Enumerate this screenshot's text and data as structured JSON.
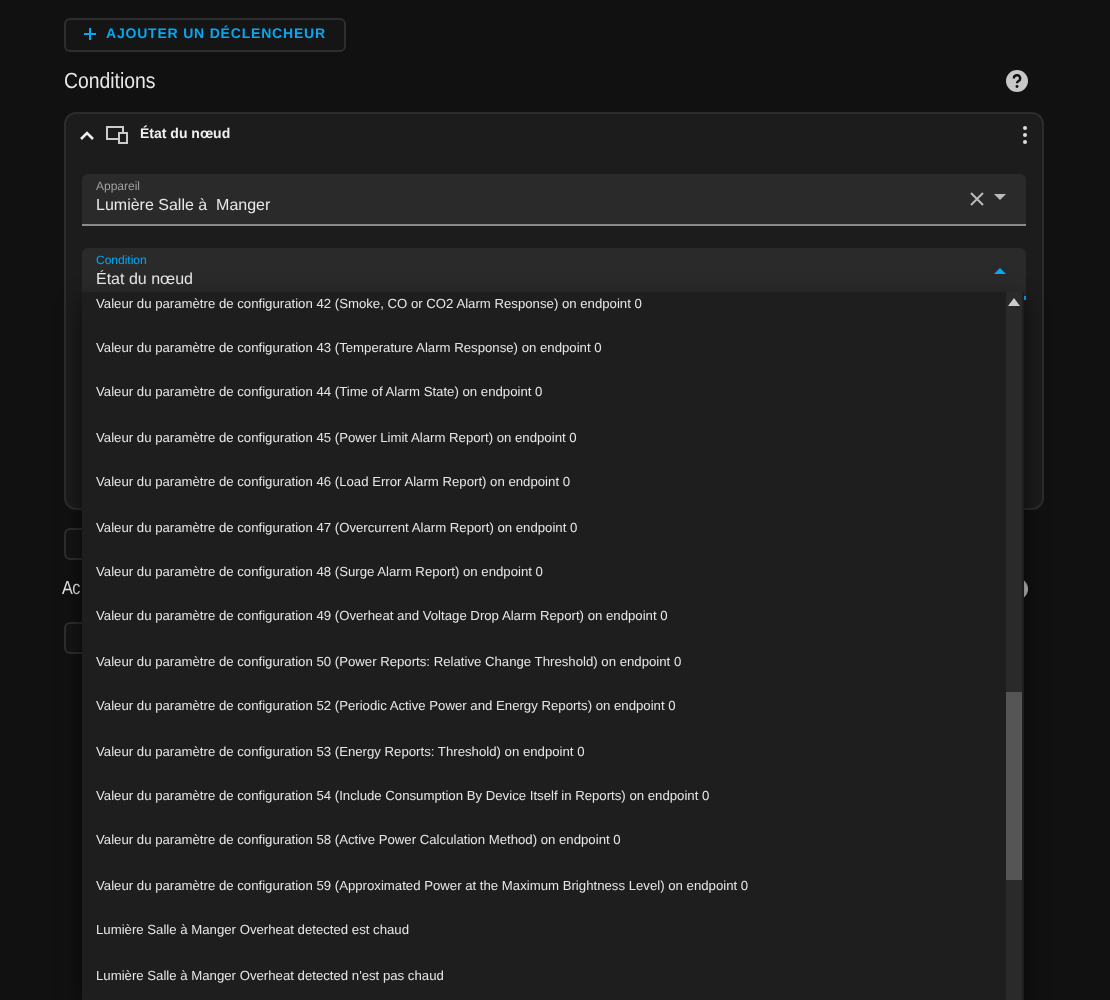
{
  "add_trigger_button": {
    "label": "AJOUTER UN DÉCLENCHEUR"
  },
  "conditions": {
    "title": "Conditions",
    "card": {
      "title": "État du nœud",
      "expanded": true,
      "fields": [
        {
          "label": "Appareil",
          "value": "Lumière Salle à  Manger",
          "focused": false,
          "clearable": true
        },
        {
          "label": "Condition",
          "value": "État du nœud",
          "focused": true,
          "clearable": false
        }
      ]
    }
  },
  "actions": {
    "title": "Ac"
  },
  "dropdown": {
    "items": [
      "Valeur du paramètre de configuration 42 (Smoke, CO or CO2 Alarm Response) on endpoint 0",
      "Valeur du paramètre de configuration 43 (Temperature Alarm Response) on endpoint 0",
      "Valeur du paramètre de configuration 44 (Time of Alarm State) on endpoint 0",
      "Valeur du paramètre de configuration 45 (Power Limit Alarm Report) on endpoint 0",
      "Valeur du paramètre de configuration 46 (Load Error Alarm Report) on endpoint 0",
      "Valeur du paramètre de configuration 47 (Overcurrent Alarm Report) on endpoint 0",
      "Valeur du paramètre de configuration 48 (Surge Alarm Report) on endpoint 0",
      "Valeur du paramètre de configuration 49 (Overheat and Voltage Drop Alarm Report) on endpoint 0",
      "Valeur du paramètre de configuration 50 (Power Reports: Relative Change Threshold) on endpoint 0",
      "Valeur du paramètre de configuration 52 (Periodic Active Power and Energy Reports) on endpoint 0",
      "Valeur du paramètre de configuration 53 (Energy Reports: Threshold) on endpoint 0",
      "Valeur du paramètre de configuration 54 (Include Consumption By Device Itself in Reports) on endpoint 0",
      "Valeur du paramètre de configuration 58 (Active Power Calculation Method) on endpoint 0",
      "Valeur du paramètre de configuration 59 (Approximated Power at the Maximum Brightness Level) on endpoint 0",
      "Lumière Salle à Manger Overheat detected est chaud",
      "Lumière Salle à Manger Overheat detected n'est pas chaud"
    ]
  }
}
